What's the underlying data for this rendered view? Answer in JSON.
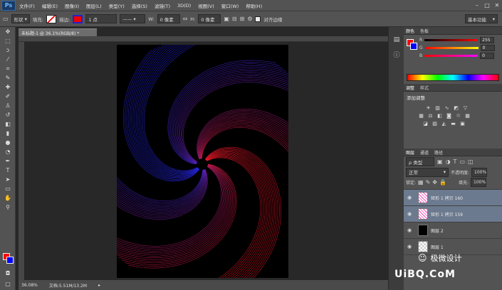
{
  "app": {
    "logo": "Ps"
  },
  "menu": [
    "文件(F)",
    "编辑(E)",
    "图像(I)",
    "图层(L)",
    "类型(Y)",
    "选择(S)",
    "滤镜(T)",
    "3D(D)",
    "视图(V)",
    "窗口(W)",
    "帮助(H)"
  ],
  "window_controls": [
    "–",
    "□",
    "✕"
  ],
  "options": {
    "mode": "形状",
    "fill_label": "填充:",
    "stroke_label": "描边:",
    "stroke_width": "1 点",
    "w_label": "W:",
    "w_value": "0 像素",
    "h_label": "H:",
    "h_value": "0 像素",
    "align_edges": "对齐边缘",
    "workspace": "基本功能"
  },
  "document": {
    "tab": "未标题-1 @ 36.1%(RGB/8) *",
    "zoom": "36.08%",
    "doc_size": "文档:5.51M/13.2M"
  },
  "color_panel": {
    "tabs": [
      "颜色",
      "色板"
    ],
    "r_label": "R",
    "r": "255",
    "g_label": "G",
    "g": "0",
    "b_label": "B",
    "b": "0"
  },
  "adjust_panel": {
    "tabs": [
      "调整",
      "样式"
    ],
    "title": "添加调整"
  },
  "layers_panel": {
    "tabs": [
      "图层",
      "通道",
      "路径"
    ],
    "filter": "ρ 类型",
    "blend": "正常",
    "opacity_label": "不透明度:",
    "opacity": "100%",
    "lock_label": "锁定:",
    "fill_label": "填充:",
    "fill": "100%",
    "layers": [
      {
        "name": "矩形 1 拷贝 160",
        "selected": true,
        "thumb": "pattern"
      },
      {
        "name": "矩形 1 拷贝 159",
        "selected": true,
        "thumb": "pattern"
      },
      {
        "name": "图层 2",
        "selected": false,
        "thumb": "black"
      },
      {
        "name": "图层 1",
        "selected": false,
        "thumb": "checker"
      }
    ]
  },
  "watermark": {
    "line1": "极微设计",
    "line2": "UiBQ.CoM"
  },
  "colors": {
    "fg": "#ff0000",
    "bg": "#0000ff",
    "red": "#ff1a2a",
    "blue": "#2a2aff"
  }
}
